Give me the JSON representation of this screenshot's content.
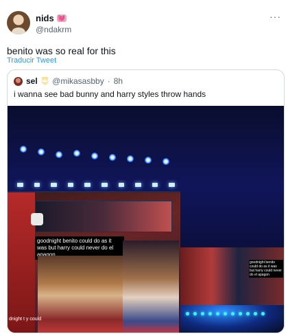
{
  "author": {
    "display_name": "nids",
    "badge": "💓",
    "handle": "@ndakrm",
    "more_icon": "more-horizontal-icon"
  },
  "tweet": {
    "text": "benito was so real for this",
    "translate_label": "Traducir Tweet"
  },
  "quoted": {
    "display_name": "sel",
    "emoji": "😇",
    "handle": "@mikasasbby",
    "separator": "·",
    "time": "8h",
    "text": "i wanna see bad bunny and harry styles throw hands",
    "media": {
      "screen_caption": "goodnight benito could do as it was but harry could never do el apagon",
      "screen_small_text": "dnight t y could",
      "right_caption": "goodnight benito could do as it was but harry could never do el apagon"
    }
  },
  "colors": {
    "link": "#1d9bf0",
    "secondary_text": "#536471",
    "border": "#cfd9de"
  }
}
